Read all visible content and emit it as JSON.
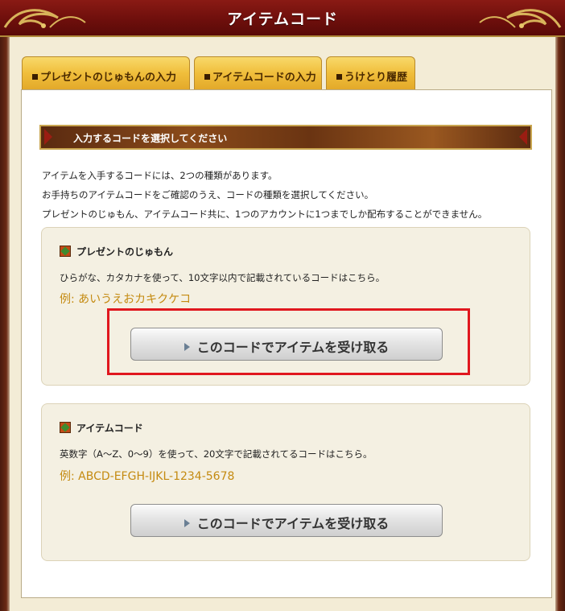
{
  "header": {
    "title": "アイテムコード"
  },
  "tabs": [
    {
      "label": "プレゼントのじゅもんの入力"
    },
    {
      "label": "アイテムコードの入力"
    },
    {
      "label": "うけとり履歴"
    }
  ],
  "section": {
    "title": "入力するコードを選択してください"
  },
  "intro": [
    "アイテムを入手するコードには、2つの種類があります。",
    "お手持ちのアイテムコードをご確認のうえ、コードの種類を選択してください。",
    "プレゼントのじゅもん、アイテムコード共に、1つのアカウントに1つまでしか配布することができません。"
  ],
  "boxes": [
    {
      "heading": "プレゼントのじゅもん",
      "description": "ひらがな、カタカナを使って、10文字以内で記載されているコードはこちら。",
      "example": "例: あいうえおカキクケコ",
      "button_label": "このコードでアイテムを受け取る"
    },
    {
      "heading": "アイテムコード",
      "description": "英数字（A〜Z、0〜9）を使って、20文字で記載されてるコードはこちら。",
      "example": "例: ABCD-EFGH-IJKL-1234-5678",
      "button_label": "このコードでアイテムを受け取る"
    }
  ],
  "colors": {
    "title_bar": "#6e0f0c",
    "tab_gold": "#f0be3b",
    "example_text": "#c48a10",
    "highlight": "#e0171e"
  },
  "icons": [
    "ornament-icon",
    "tab-square-icon",
    "arrow-left-icon",
    "arrow-right-icon",
    "gem-icon",
    "play-triangle-icon"
  ]
}
